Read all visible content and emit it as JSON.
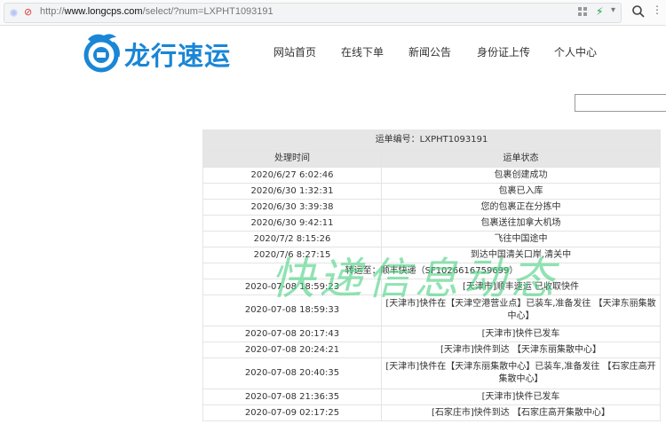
{
  "browser": {
    "url_prefix": "http://",
    "url_domain": "www.longcps.com",
    "url_path": "/select/?num=LXPHT1093191"
  },
  "brand": {
    "name": "龙行速运",
    "accent": "#1a86d6"
  },
  "nav": {
    "items": [
      {
        "label": "网站首页"
      },
      {
        "label": "在线下单"
      },
      {
        "label": "新闻公告"
      },
      {
        "label": "身份证上传"
      },
      {
        "label": "个人中心"
      }
    ]
  },
  "search": {
    "value": ""
  },
  "tracking": {
    "order_label": "运单编号：LXPHT1093191",
    "col_time": "处理时间",
    "col_status": "运单状态",
    "rows_before": [
      {
        "time": "2020/6/27 6:02:46",
        "status": "包裹创建成功"
      },
      {
        "time": "2020/6/30 1:32:31",
        "status": "包裹已入库"
      },
      {
        "time": "2020/6/30 3:39:38",
        "status": "您的包裹正在分拣中"
      },
      {
        "time": "2020/6/30 9:42:11",
        "status": "包裹送往加拿大机场"
      },
      {
        "time": "2020/7/2 8:15:26",
        "status": "飞往中国途中"
      },
      {
        "time": "2020/7/6 8:27:15",
        "status": "到达中国清关口岸,清关中"
      }
    ],
    "transfer": "转运至：顺丰快递（SF1026616759699）",
    "rows_after": [
      {
        "time": "2020-07-08 18:59:23",
        "status": "[天津市]顺丰速运 已收取快件"
      },
      {
        "time": "2020-07-08 18:59:33",
        "status": "[天津市]快件在【天津空港营业点】已装车,准备发往 【天津东丽集散中心】"
      },
      {
        "time": "2020-07-08 20:17:43",
        "status": "[天津市]快件已发车"
      },
      {
        "time": "2020-07-08 20:24:21",
        "status": "[天津市]快件到达 【天津东丽集散中心】"
      },
      {
        "time": "2020-07-08 20:40:35",
        "status": "[天津市]快件在【天津东丽集散中心】已装车,准备发往 【石家庄高开集散中心】"
      },
      {
        "time": "2020-07-08 21:36:35",
        "status": "[天津市]快件已发车"
      },
      {
        "time": "2020-07-09 02:17:25",
        "status": "[石家庄市]快件到达 【石家庄高开集散中心】"
      }
    ]
  },
  "watermark": "快递信息动态"
}
